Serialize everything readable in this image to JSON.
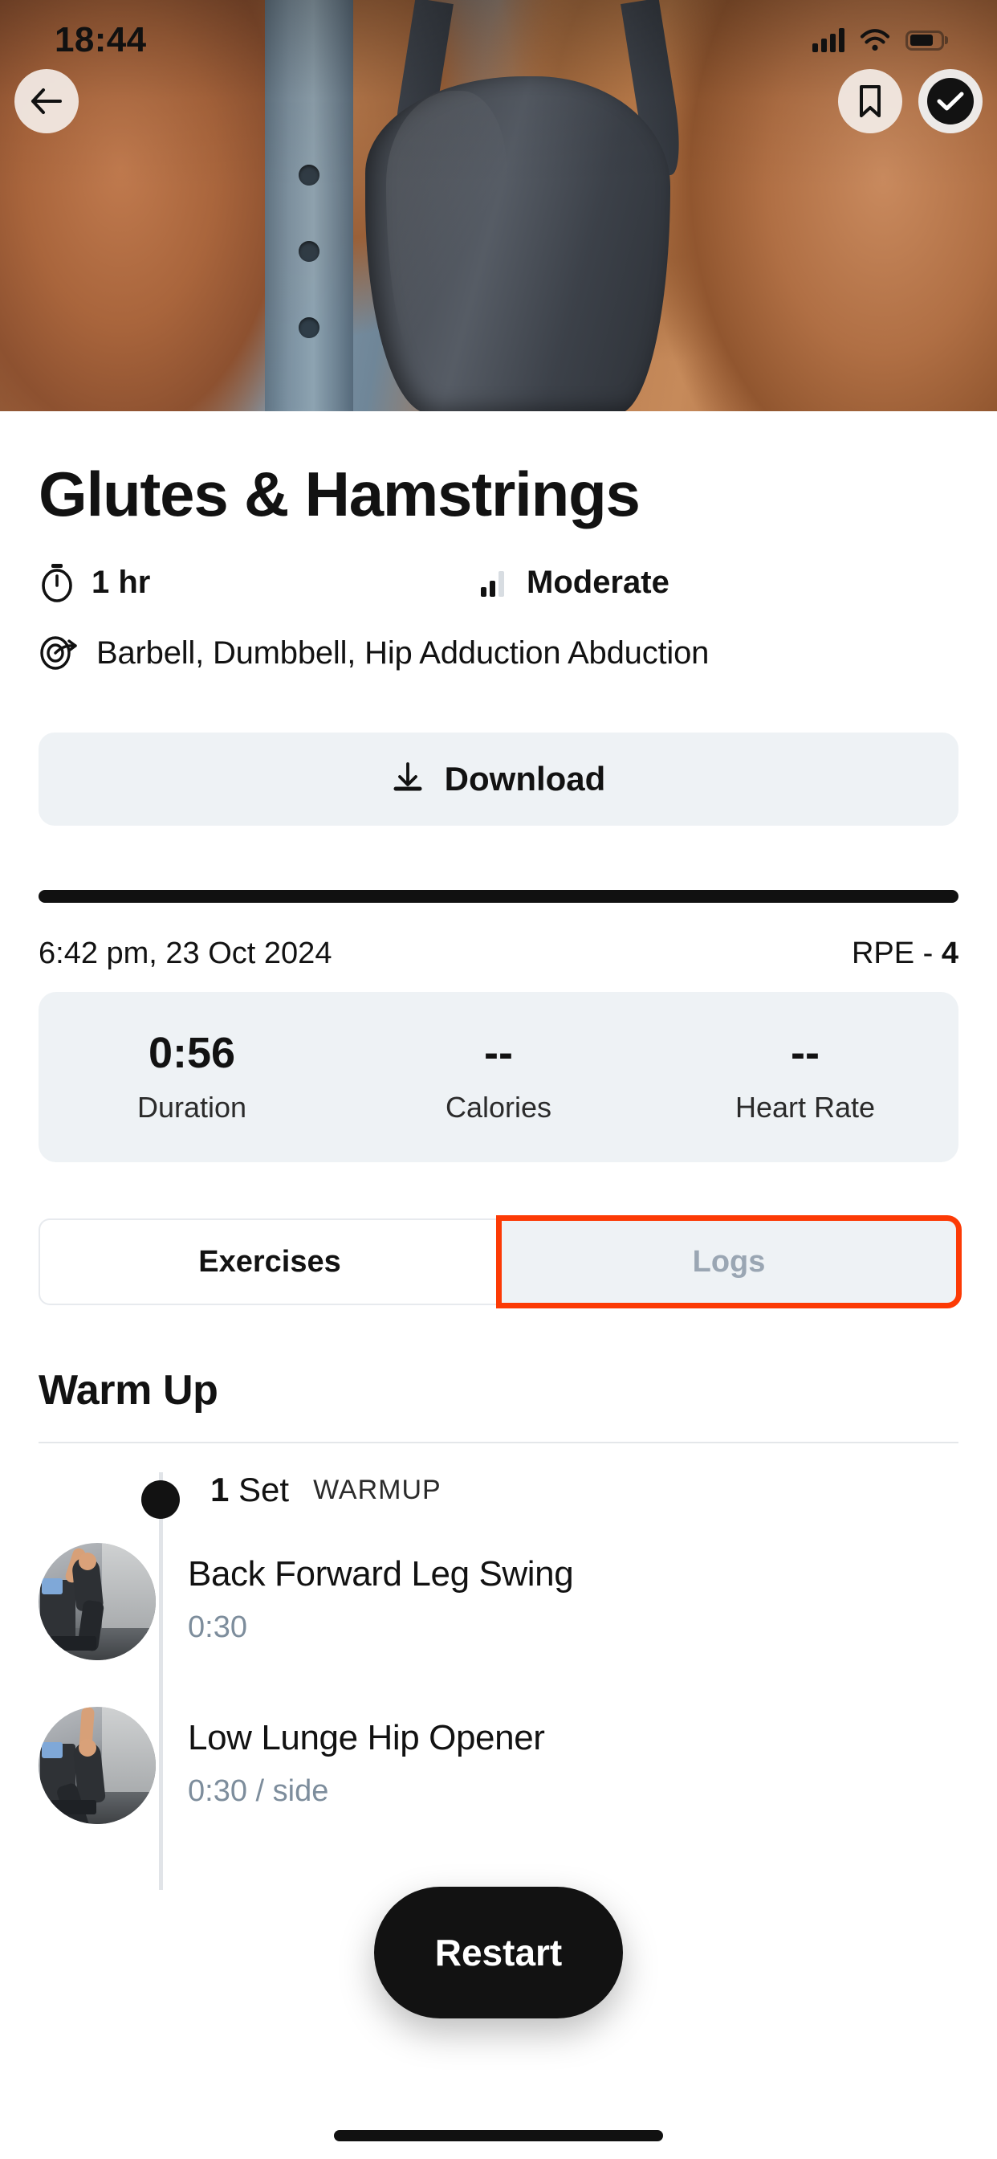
{
  "status_bar": {
    "time": "18:44",
    "signal_icon": "cellular-signal-icon",
    "wifi_icon": "wifi-icon",
    "battery_icon": "battery-icon"
  },
  "header": {
    "back_icon": "back-arrow-icon",
    "bookmark_icon": "bookmark-icon",
    "complete_icon": "check-circle-icon"
  },
  "workout": {
    "title": "Glutes & Hamstrings",
    "duration_icon": "stopwatch-icon",
    "duration": "1 hr",
    "intensity_icon": "signal-bars-icon",
    "intensity": "Moderate",
    "equipment_icon": "equipment-swirl-icon",
    "equipment": "Barbell, Dumbbell, Hip Adduction Abduction"
  },
  "download": {
    "icon": "download-icon",
    "label": "Download"
  },
  "log_summary": {
    "date": "6:42 pm, 23 Oct 2024",
    "rpe_label": "RPE - ",
    "rpe_value": "4",
    "stats": [
      {
        "value": "0:56",
        "label": "Duration"
      },
      {
        "value": "--",
        "label": "Calories"
      },
      {
        "value": "--",
        "label": "Heart Rate"
      }
    ]
  },
  "tabs": [
    {
      "label": "Exercises",
      "active": true
    },
    {
      "label": "Logs",
      "active": false,
      "highlighted": true
    }
  ],
  "section": {
    "heading": "Warm Up",
    "set_count": "1",
    "set_word": " Set",
    "set_tag": "WARMUP"
  },
  "exercises": [
    {
      "name": "Back Forward Leg Swing",
      "detail": "0:30",
      "thumb": "exercise-thumbnail"
    },
    {
      "name": "Low Lunge Hip Opener",
      "detail": "0:30 / side",
      "thumb": "exercise-thumbnail"
    }
  ],
  "fab": {
    "label": "Restart"
  },
  "colors": {
    "accent_highlight": "#fc3a05",
    "surface": "#eef2f5",
    "text_primary": "#121212",
    "text_muted": "#7d8d9c",
    "tab_inactive_text": "#9aa6b3"
  }
}
